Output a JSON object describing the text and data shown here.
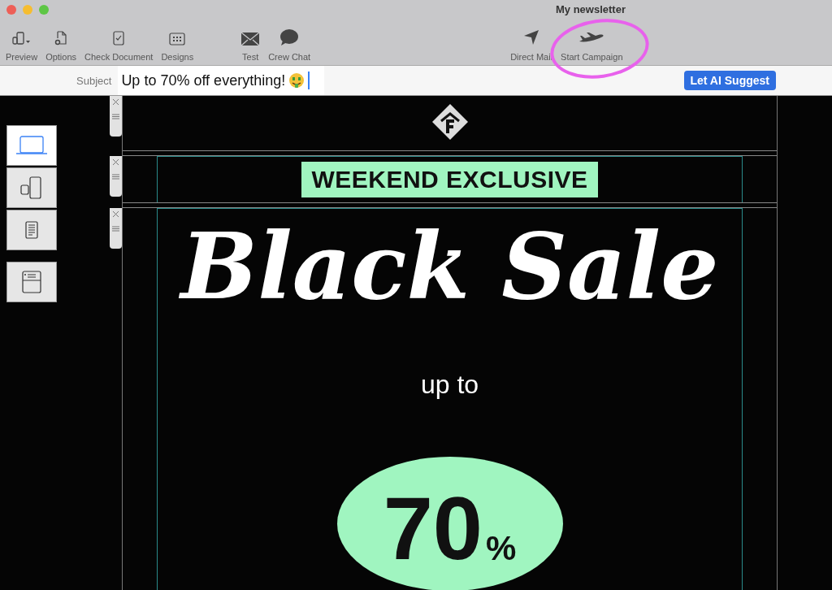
{
  "window": {
    "title": "My newsletter"
  },
  "toolbar": {
    "groups": [
      {
        "items": [
          {
            "label": "Preview"
          },
          {
            "label": "Options"
          },
          {
            "label": "Check Document"
          },
          {
            "label": "Designs"
          }
        ]
      },
      {
        "items": [
          {
            "label": "Test"
          },
          {
            "label": "Crew Chat"
          }
        ]
      },
      {
        "items": [
          {
            "label": "Direct Mail",
            "circled": false
          },
          {
            "label": "Start Campaign",
            "circled": true
          }
        ]
      }
    ]
  },
  "subject": {
    "label": "Subject",
    "value": "Up to 70% off everything!",
    "button": "Let AI Suggest"
  },
  "devices": [
    {
      "kind": "desktop",
      "selected": true
    },
    {
      "kind": "mobile",
      "selected": false
    },
    {
      "kind": "text",
      "selected": false
    },
    {
      "kind": "inbox",
      "selected": false
    }
  ],
  "email": {
    "badge": "WEEKEND EXCLUSIVE",
    "headline": "Black Sale",
    "subline": "up to",
    "discount": "70",
    "unit": "%"
  }
}
